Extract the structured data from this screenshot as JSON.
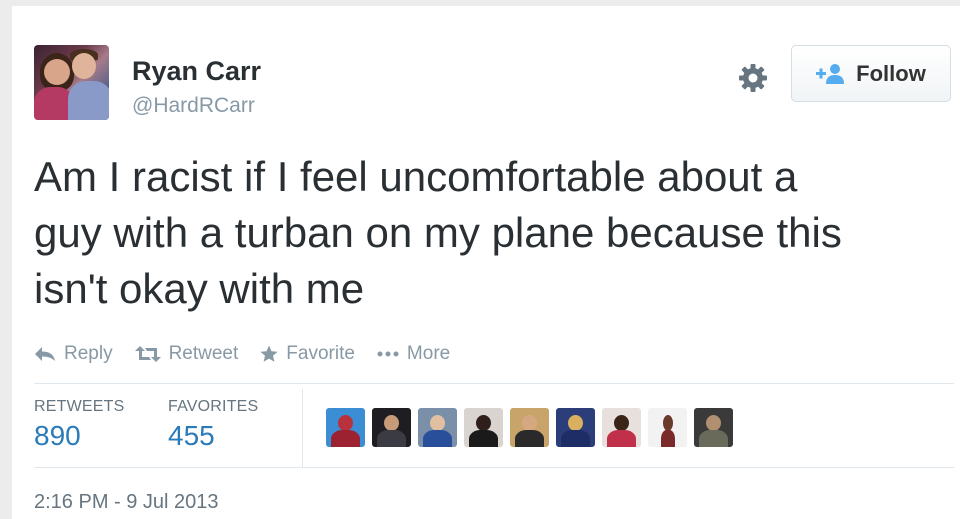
{
  "user": {
    "name": "Ryan Carr",
    "handle": "@HardRCarr"
  },
  "follow_label": "Follow",
  "tweet": {
    "lines": [
      "Am I racist if I feel uncomfortable about a",
      "guy with a turban on my plane because this",
      "isn't okay with me"
    ]
  },
  "actions": {
    "reply": "Reply",
    "retweet": "Retweet",
    "favorite": "Favorite",
    "more": "More"
  },
  "stats": {
    "retweets_label": "RETWEETS",
    "retweets_value": "890",
    "favorites_label": "FAVORITES",
    "favorites_value": "455"
  },
  "timestamp": "2:16 PM - 9 Jul 2013",
  "colors": {
    "link": "#2b7bb9",
    "muted": "#8899a6",
    "text": "#292f33",
    "follow_icon": "#55acee"
  }
}
